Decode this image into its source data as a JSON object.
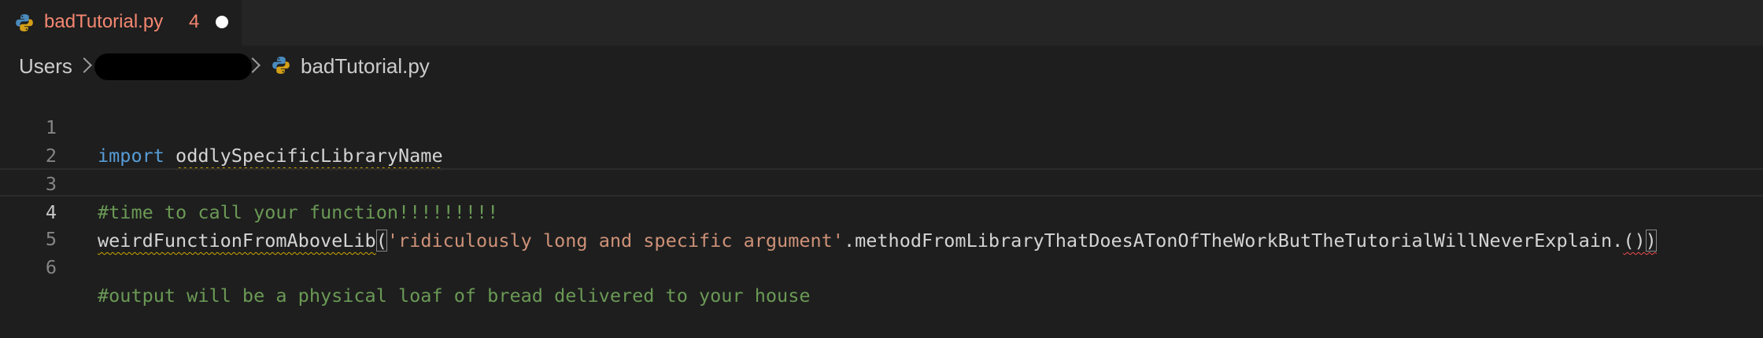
{
  "tab": {
    "filename": "badTutorial.py",
    "problem_count": "4",
    "dirty": true
  },
  "breadcrumb": {
    "root": "Users",
    "file": "badTutorial.py"
  },
  "editor": {
    "line_numbers": [
      "1",
      "2",
      "3",
      "4",
      "5",
      "6"
    ],
    "current_line": 4,
    "lines": {
      "l1": {
        "keyword": "import",
        "module": "oddlySpecificLibraryName"
      },
      "l3": {
        "comment": "#time to call your function!!!!!!!!!"
      },
      "l4": {
        "func": "weirdFunctionFromAboveLib",
        "open_paren": "(",
        "string": "'ridiculously long and specific argument'",
        "method": ".methodFromLibraryThatDoesATonOfTheWorkButTheTutorialWillNeverExplain.",
        "inner_parens": "()",
        "close_paren": ")"
      },
      "l6": {
        "comment": "#output will be a physical loaf of bread delivered to your house"
      }
    }
  },
  "colors": {
    "tab_error_text": "#f48771",
    "keyword": "#569cd6",
    "string": "#ce9178",
    "comment": "#6a9955",
    "warning_squiggle": "#cca700",
    "error_squiggle": "#f14c4c"
  },
  "icons": {
    "tab_icon": "python-icon",
    "breadcrumb_file_icon": "python-icon"
  }
}
